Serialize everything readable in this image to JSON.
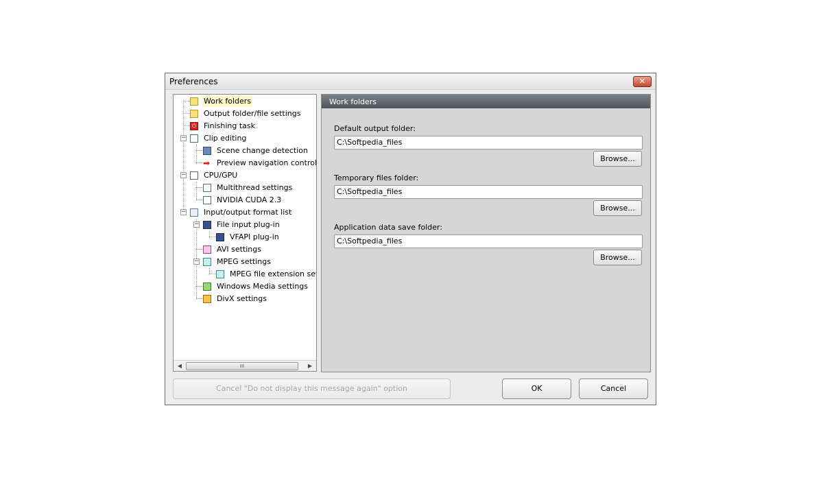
{
  "window": {
    "title": "Preferences",
    "close_glyph": "✕"
  },
  "tree": {
    "items": [
      {
        "label": "Work folders",
        "icon": "folder-icon",
        "selected": true
      },
      {
        "label": "Output folder/file settings",
        "icon": "folder-file-icon"
      },
      {
        "label": "Finishing task",
        "icon": "power-icon"
      },
      {
        "label": "Clip editing",
        "icon": "edit-icon"
      },
      {
        "label": "Scene change detection",
        "icon": "film-icon"
      },
      {
        "label": "Preview navigation control",
        "icon": "arrow-icon"
      },
      {
        "label": "CPU/GPU",
        "icon": "edit-icon"
      },
      {
        "label": "Multithread settings",
        "icon": "edit-icon"
      },
      {
        "label": "NVIDIA CUDA 2.3",
        "icon": "edit-icon"
      },
      {
        "label": "Input/output format list",
        "icon": "list-icon"
      },
      {
        "label": "File input plug-in",
        "icon": "plug-icon"
      },
      {
        "label": "VFAPI plug-in",
        "icon": "plug-icon"
      },
      {
        "label": "AVI settings",
        "icon": "avi-icon"
      },
      {
        "label": "MPEG settings",
        "icon": "mpeg-icon"
      },
      {
        "label": "MPEG file extension setting",
        "icon": "mpeg-icon"
      },
      {
        "label": "Windows Media settings",
        "icon": "wmv-icon"
      },
      {
        "label": "DivX settings",
        "icon": "divx-icon"
      }
    ],
    "scroll_thumb_glyph": "III"
  },
  "panel": {
    "header": "Work folders",
    "fields": [
      {
        "label": "Default output folder:",
        "value": "C:\\Softpedia_files",
        "button": "Browse..."
      },
      {
        "label": "Temporary files folder:",
        "value": "C:\\Softpedia_files",
        "button": "Browse..."
      },
      {
        "label": "Application data save folder:",
        "value": "C:\\Softpedia_files",
        "button": "Browse..."
      }
    ]
  },
  "footer": {
    "cancel_option": "Cancel \"Do not display this message again\" option",
    "ok": "OK",
    "cancel": "Cancel"
  }
}
